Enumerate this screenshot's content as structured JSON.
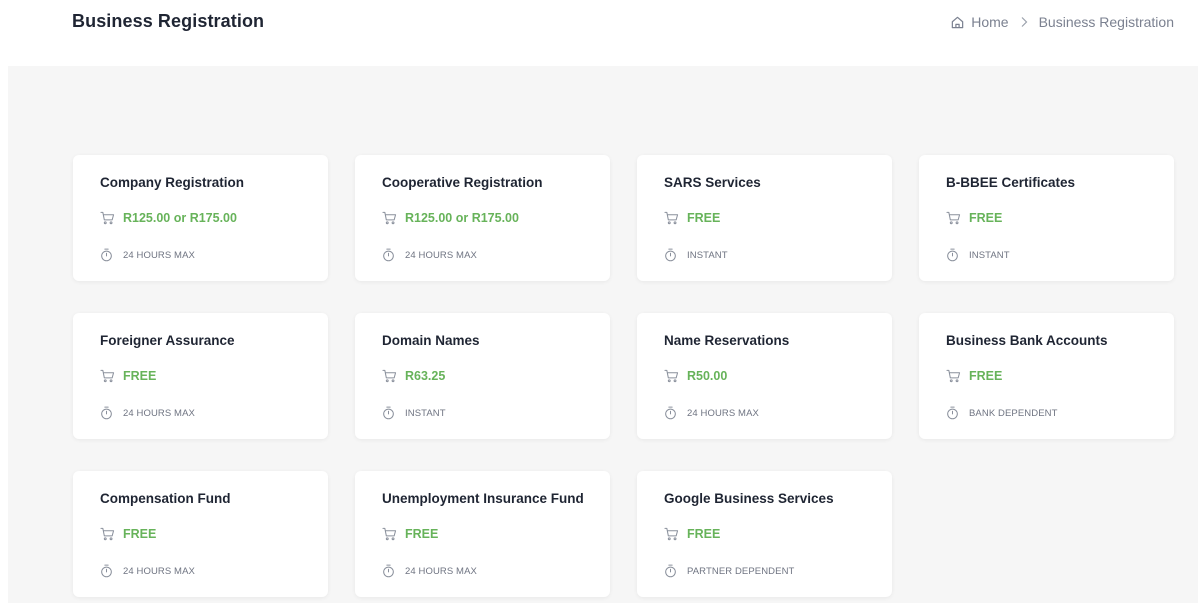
{
  "header": {
    "title": "Business Registration",
    "breadcrumb": {
      "home": "Home",
      "current": "Business Registration",
      "icons": {
        "home": "home-icon",
        "separator": "chevron-right-icon"
      }
    }
  },
  "colors": {
    "accent_green": "#67b35a",
    "title": "#1f2533",
    "muted": "#7b8190",
    "content_bg": "#f6f6f6"
  },
  "icons": {
    "price": "cart-icon",
    "time": "timer-icon"
  },
  "services": [
    {
      "title": "Company Registration",
      "price": "R125.00 or R175.00",
      "time": "24 HOURS MAX"
    },
    {
      "title": "Cooperative Registration",
      "price": "R125.00 or R175.00",
      "time": "24 HOURS MAX"
    },
    {
      "title": "SARS Services",
      "price": "FREE",
      "time": "INSTANT"
    },
    {
      "title": "B-BBEE Certificates",
      "price": "FREE",
      "time": "INSTANT"
    },
    {
      "title": "Foreigner Assurance",
      "price": "FREE",
      "time": "24 HOURS MAX"
    },
    {
      "title": "Domain Names",
      "price": "R63.25",
      "time": "INSTANT"
    },
    {
      "title": "Name Reservations",
      "price": "R50.00",
      "time": "24 HOURS MAX"
    },
    {
      "title": "Business Bank Accounts",
      "price": "FREE",
      "time": "BANK DEPENDENT"
    },
    {
      "title": "Compensation Fund",
      "price": "FREE",
      "time": "24 HOURS MAX"
    },
    {
      "title": "Unemployment Insurance Fund",
      "price": "FREE",
      "time": "24 HOURS MAX"
    },
    {
      "title": "Google Business Services",
      "price": "FREE",
      "time": "PARTNER DEPENDENT"
    }
  ]
}
